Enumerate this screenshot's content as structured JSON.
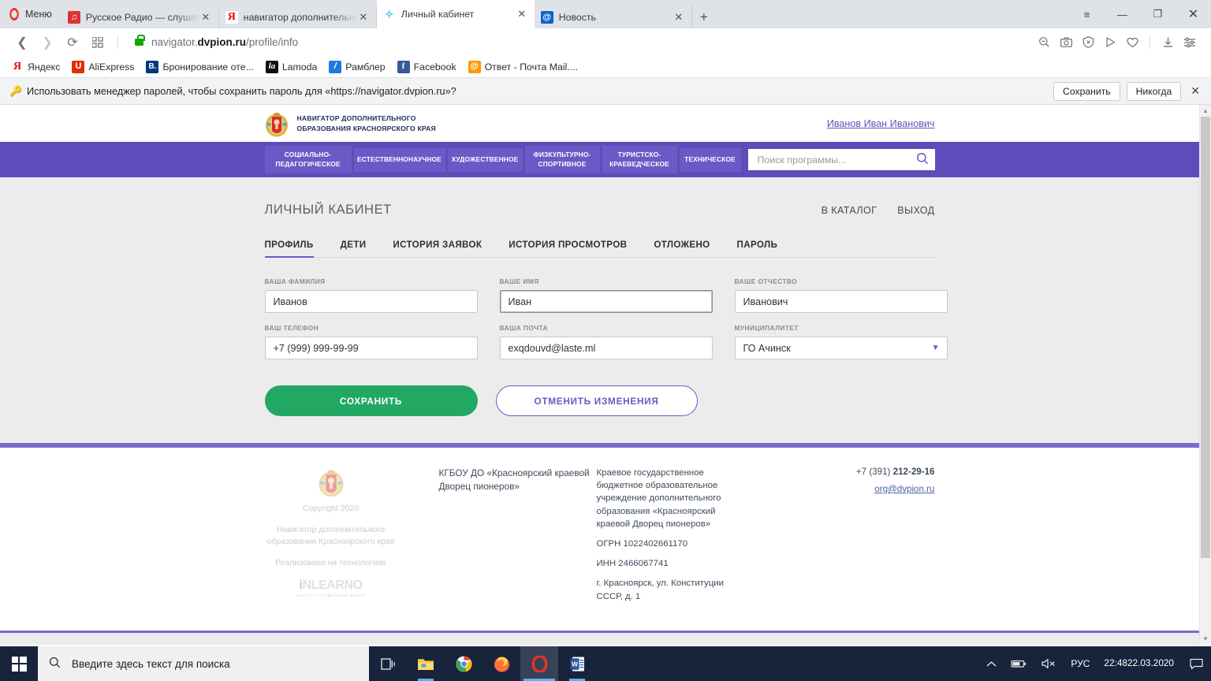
{
  "browser": {
    "menu_label": "Меню",
    "tabs": [
      {
        "title": "Русское Радио — слушать",
        "favicon": "radio-icon",
        "active": false
      },
      {
        "title": "навигатор дополнительно",
        "favicon": "yandex-icon",
        "active": false
      },
      {
        "title": "Личный кабинет",
        "favicon": "navigator-icon",
        "active": true
      },
      {
        "title": "Новость",
        "favicon": "mail-icon",
        "active": false
      }
    ],
    "new_tab_label": "+",
    "window_controls": {
      "minimize": "—",
      "maximize": "❐",
      "close": "✕",
      "menu": "≡"
    },
    "nav": {
      "back_icon": "back-arrow-icon",
      "forward_icon": "forward-arrow-icon",
      "reload_icon": "reload-icon",
      "speeddial_icon": "speed-dial-icon"
    },
    "url": {
      "scheme_lock": "secure-lock-icon",
      "host_prefix": "navigator.",
      "host_bold": "dvpion.ru",
      "path": "/profile/info"
    },
    "toolbar_icons": [
      "zoom-out-icon",
      "snapshot-icon",
      "ad-block-icon",
      "send-icon",
      "heart-icon",
      "download-icon",
      "settings-sliders-icon"
    ],
    "bookmarks": [
      {
        "label": "Яндекс",
        "icon": "yandex-icon"
      },
      {
        "label": "AliExpress",
        "icon": "aliexpress-icon"
      },
      {
        "label": "Бронирование оте...",
        "icon": "booking-icon"
      },
      {
        "label": "Lamoda",
        "icon": "lamoda-icon"
      },
      {
        "label": "Рамблер",
        "icon": "rambler-icon"
      },
      {
        "label": "Facebook",
        "icon": "facebook-icon"
      },
      {
        "label": "Ответ - Почта Mail....",
        "icon": "mailru-icon"
      }
    ],
    "password_bar": {
      "icon": "key-icon",
      "message": "Использовать менеджер паролей, чтобы сохранить пароль для «https://navigator.dvpion.ru»?",
      "save_label": "Сохранить",
      "never_label": "Никогда",
      "close_icon": "close-icon"
    }
  },
  "site": {
    "header": {
      "logo_icon": "krasnoyarsk-coat-of-arms",
      "brand_line1": "НАВИГАТОР ДОПОЛНИТЕЛЬНОГО",
      "brand_line2": "ОБРАЗОВАНИЯ КРАСНОЯРСКОГО КРАЯ",
      "user_name": "Иванов Иван Иванович"
    },
    "nav": {
      "categories": [
        {
          "line1": "СОЦИАЛЬНО-",
          "line2": "ПЕДАГОГИЧЕСКОЕ"
        },
        {
          "line1": "ЕСТЕСТВЕННОНАУЧНОЕ",
          "line2": ""
        },
        {
          "line1": "ХУДОЖЕСТВЕННОЕ",
          "line2": ""
        },
        {
          "line1": "ФИЗКУЛЬТУРНО-",
          "line2": "СПОРТИВНОЕ"
        },
        {
          "line1": "ТУРИСТСКО-",
          "line2": "КРАЕВЕДЧЕСКОЕ"
        },
        {
          "line1": "ТЕХНИЧЕСКОЕ",
          "line2": ""
        }
      ],
      "search_placeholder": "Поиск программы...",
      "search_value": "",
      "search_icon": "search-icon"
    },
    "page": {
      "title": "ЛИЧНЫЙ КАБИНЕТ",
      "top_links": [
        "В КАТАЛОГ",
        "ВЫХОД"
      ],
      "tabs": [
        {
          "label": "ПРОФИЛЬ",
          "active": true
        },
        {
          "label": "ДЕТИ",
          "active": false
        },
        {
          "label": "ИСТОРИЯ ЗАЯВОК",
          "active": false
        },
        {
          "label": "ИСТОРИЯ ПРОСМОТРОВ",
          "active": false
        },
        {
          "label": "ОТЛОЖЕНО",
          "active": false
        },
        {
          "label": "ПАРОЛЬ",
          "active": false
        }
      ],
      "fields": [
        {
          "label": "ВАША ФАМИЛИЯ",
          "value": "Иванов",
          "type": "text",
          "focused": false
        },
        {
          "label": "ВАШЕ ИМЯ",
          "value": "Иван",
          "type": "text",
          "focused": true
        },
        {
          "label": "ВАШЕ ОТЧЕСТВО",
          "value": "Иванович",
          "type": "text",
          "focused": false
        },
        {
          "label": "ВАШ ТЕЛЕФОН",
          "value": "+7 (999) 999-99-99",
          "type": "text",
          "focused": false
        },
        {
          "label": "ВАША ПОЧТА",
          "value": "exqdouvd@laste.ml",
          "type": "text",
          "focused": false
        },
        {
          "label": "МУНИЦИПАЛИТЕТ",
          "value": "ГО Ачинск",
          "type": "select",
          "focused": false
        }
      ],
      "buttons": {
        "save": "СОХРАНИТЬ",
        "cancel": "ОТМЕНИТЬ ИЗМЕНЕНИЯ"
      }
    },
    "footer": {
      "logo_icon": "krasnoyarsk-coat-of-arms",
      "copyright": "Copyright 2020",
      "org_short": "Навигатор дополнительного образования Красноярского края",
      "tech_label": "Реализовано на технологиях",
      "inlearno_big_i": "i",
      "inlearno_big_rest": "NLEARNO",
      "inlearno_tagline_a": "НАВИГАТОР ПО ",
      "inlearno_tagline_b": "ДЕТСКОМУ ДОСУГУ",
      "org_name": "КГБОУ ДО «Красноярский краевой Дворец пионеров»",
      "legal_desc": "Краевое государственное бюджетное образовательное учреждение дополнительного образования «Красноярский краевой Дворец пионеров»",
      "ogrn": "ОГРН 1022402661170",
      "inn": "ИНН 2466067741",
      "address": "г. Красноярск, ул. Конституции СССР, д. 1",
      "phone_prefix": "+7 (391) ",
      "phone_number": "212-29-16",
      "email": "org@dvpion.ru"
    },
    "colors": {
      "purple": "#5d4dbb",
      "purple_light": "#6a5ac5",
      "purple_rule": "#7a6bd0",
      "green": "#23a863",
      "page_bg": "#ececec"
    }
  },
  "taskbar": {
    "start_icon": "windows-start-icon",
    "search_placeholder": "Введите здесь текст для поиска",
    "search_icon": "search-icon",
    "items": [
      {
        "name": "task-view-icon"
      },
      {
        "name": "file-explorer-icon"
      },
      {
        "name": "chrome-icon"
      },
      {
        "name": "firefox-icon"
      },
      {
        "name": "opera-icon"
      },
      {
        "name": "word-icon"
      }
    ],
    "tray": {
      "chevron_icon": "chevron-up-icon",
      "battery_icon": "battery-icon",
      "volume_icon": "volume-muted-icon",
      "language": "РУС",
      "time": "22:48",
      "date": "22.03.2020",
      "notifications_icon": "notifications-icon"
    }
  }
}
